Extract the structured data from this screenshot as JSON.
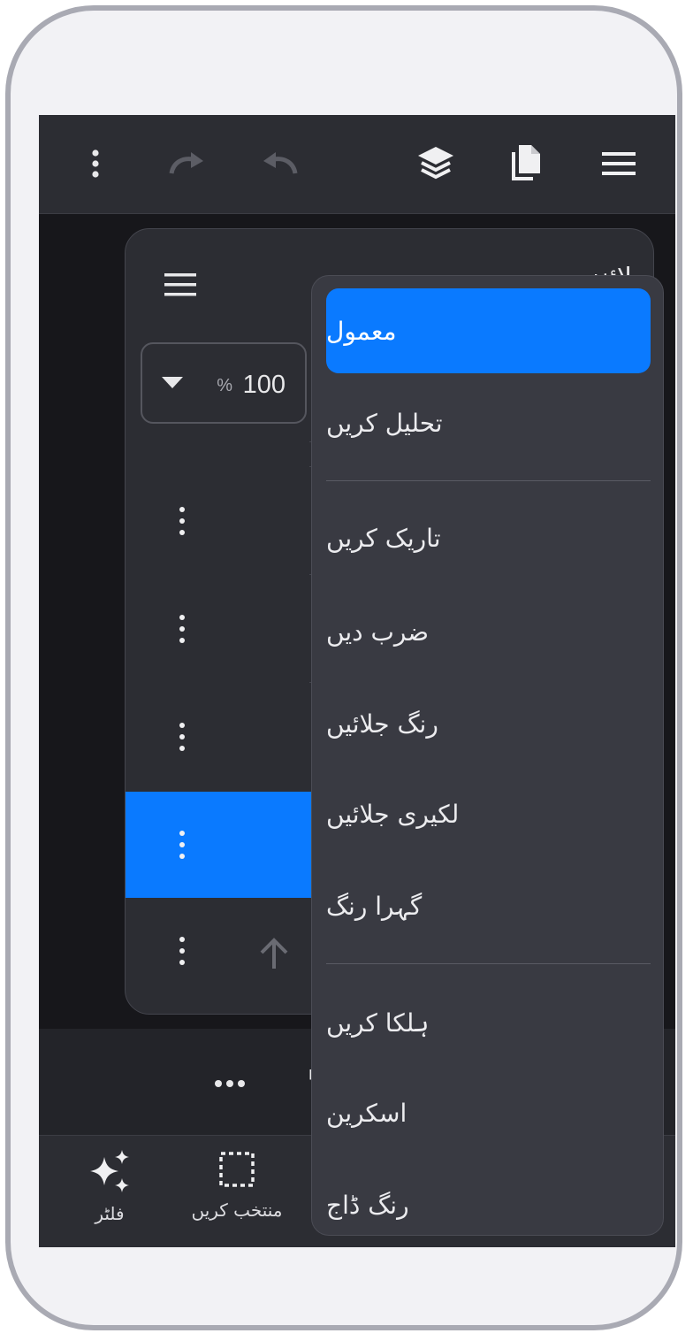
{
  "toolbar": {
    "icons": [
      "menu-icon",
      "pages-icon",
      "layers-icon",
      "undo-icon",
      "redo-icon",
      "more-vertical-icon"
    ]
  },
  "layers_panel": {
    "title": "لائنز",
    "opacity_value": "100",
    "opacity_unit": "%",
    "rows": [
      {
        "selected": false
      },
      {
        "selected": false
      },
      {
        "selected": false
      },
      {
        "selected": true
      },
      {
        "selected": false
      }
    ]
  },
  "blend_menu": {
    "selected": "معمول",
    "items": [
      "معمول",
      "تحلیل کریں",
      "تاریک کریں",
      "ضرب دیں",
      "رنگ جلائیں",
      "لکیری جلائیں",
      "گہرا رنگ",
      "ہلکا کریں",
      "اسکرین",
      "رنگ ڈاج"
    ]
  },
  "bottom_nav": {
    "filter_label": "فلٹر",
    "select_label": "منتخب کریں"
  },
  "colors": {
    "accent": "#0a7aff",
    "surface": "#2c2d33",
    "menu_bg": "#393a42",
    "canvas_bg": "#17171b",
    "frame": "#a9aab3"
  }
}
